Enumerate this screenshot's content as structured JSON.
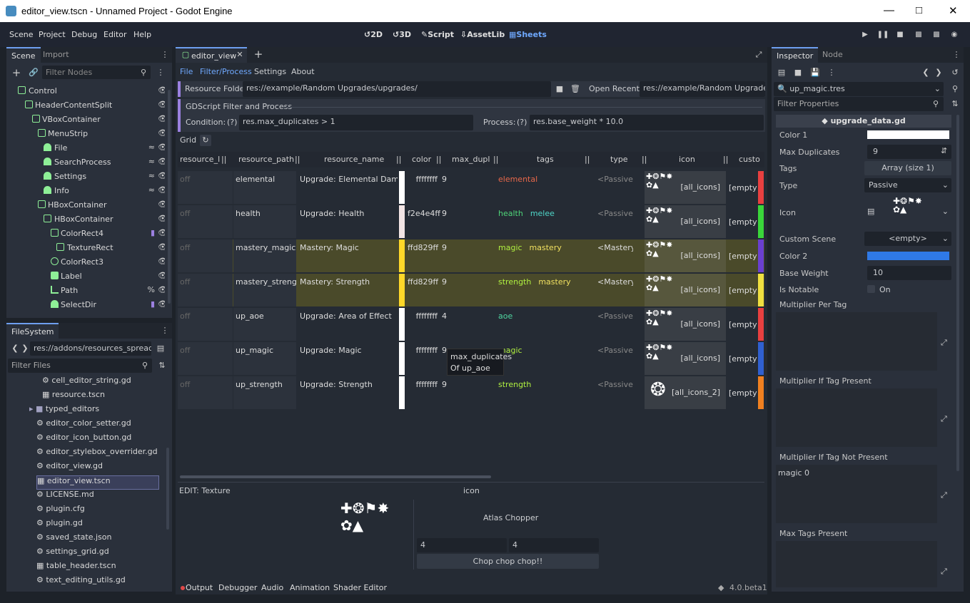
{
  "window": {
    "title": "editor_view.tscn - Unnamed Project - Godot Engine"
  },
  "menu": [
    "Scene",
    "Project",
    "Debug",
    "Editor",
    "Help"
  ],
  "workspaces": [
    "2D",
    "3D",
    "Script",
    "AssetLib",
    "Sheets"
  ],
  "scene_dock": {
    "tabs": [
      "Scene",
      "Import"
    ],
    "filter_placeholder": "Filter Nodes",
    "nodes": [
      "Control",
      "HeaderContentSplit",
      "VBoxContainer",
      "MenuStrip",
      "File",
      "SearchProcess",
      "Settings",
      "Info",
      "HBoxContainer",
      "HBoxContainer",
      "ColorRect4",
      "TextureRect",
      "ColorRect3",
      "Label",
      "Path",
      "SelectDir"
    ]
  },
  "filesystem": {
    "tab": "FileSystem",
    "path": "res://addons/resources_spreadshe",
    "filter_placeholder": "Filter Files",
    "files": [
      "cell_editor_string.gd",
      "resource.tscn",
      "typed_editors",
      "editor_color_setter.gd",
      "editor_icon_button.gd",
      "editor_stylebox_overrider.gd",
      "editor_view.gd",
      "editor_view.tscn",
      "LICENSE.md",
      "plugin.cfg",
      "plugin.gd",
      "saved_state.json",
      "settings_grid.gd",
      "table_header.tscn",
      "text_editing_utils.gd"
    ]
  },
  "center": {
    "tab": "editor_view",
    "submenu": [
      "File",
      "Filter/Process",
      "Settings",
      "About"
    ],
    "resource_folder_label": "Resource Folder:",
    "resource_folder": "res://example/Random Upgrades/upgrades/",
    "open_recent_label": "Open Recent:",
    "open_recent": "res://example/Random Upgrades/u",
    "gdscript_title": "GDScript Filter and Process",
    "condition_label": "Condition:",
    "condition_help": "(?)",
    "condition": "res.max_duplicates > 1",
    "process_label": "Process:",
    "process_help": "(?)",
    "process": "res.base_weight * 10.0",
    "grid_label": "Grid",
    "columns": [
      "resource_l",
      "resource_path",
      "resource_name",
      "color",
      "max_dupl",
      "tags",
      "type",
      "icon",
      "custo"
    ],
    "rows": [
      {
        "lock": "off",
        "path": "elemental",
        "name": "Upgrade: Elemental Damage",
        "color": "ffffffff",
        "swatch": "#ffffff",
        "dup": "9",
        "tags": [
          {
            "t": "elemental",
            "c": "#e8684a"
          }
        ],
        "type": "<Passive>",
        "icon": "[all_icons]",
        "custom": "[empty]",
        "bar": "#e84040",
        "hl": ""
      },
      {
        "lock": "off",
        "path": "health",
        "name": "Upgrade: Health",
        "color": "f2e4e4ff",
        "swatch": "#f2e4e4",
        "dup": "9",
        "tags": [
          {
            "t": "health",
            "c": "#4fd67a"
          },
          {
            "t": "melee",
            "c": "#4fd6c8"
          }
        ],
        "type": "<Passive>",
        "icon": "[all_icons]",
        "custom": "[empty]",
        "bar": "#3ad63a",
        "hl": ""
      },
      {
        "lock": "off",
        "path": "mastery_magic",
        "name": "Mastery: Magic",
        "color": "ffd829ff",
        "swatch": "#ffd829",
        "dup": "9",
        "tags": [
          {
            "t": "magic",
            "c": "#b0f040"
          },
          {
            "t": "mastery",
            "c": "#f0e060"
          }
        ],
        "type": "<Mastery>",
        "icon": "[all_icons]",
        "custom": "[empty]",
        "bar": "#6a3fd0",
        "hl": "#4a4a2a"
      },
      {
        "lock": "off",
        "path": "mastery_strength",
        "name": "Mastery: Strength",
        "color": "ffd829ff",
        "swatch": "#ffd829",
        "dup": "9",
        "tags": [
          {
            "t": "strength",
            "c": "#b0f040"
          },
          {
            "t": "mastery",
            "c": "#f0e060"
          }
        ],
        "type": "<Mastery>",
        "icon": "[all_icons]",
        "custom": "[empty]",
        "bar": "#f0e040",
        "hl": "#4a4a2a"
      },
      {
        "lock": "off",
        "path": "up_aoe",
        "name": "Upgrade: Area of Effect",
        "color": "ffffffff",
        "swatch": "#ffffff",
        "dup": "4",
        "tags": [
          {
            "t": "aoe",
            "c": "#4fd6a0"
          }
        ],
        "type": "<Passive>",
        "icon": "[all_icons]",
        "custom": "[empty]",
        "bar": "#e84040",
        "hl": ""
      },
      {
        "lock": "off",
        "path": "up_magic",
        "name": "Upgrade: Magic",
        "color": "ffffffff",
        "swatch": "#ffffff",
        "dup": "9",
        "tags": [
          {
            "t": "magic",
            "c": "#b0f040"
          }
        ],
        "type": "<Passive>",
        "icon": "[all_icons]",
        "custom": "[empty]",
        "bar": "#3060d0",
        "hl": ""
      },
      {
        "lock": "off",
        "path": "up_strength",
        "name": "Upgrade: Strength",
        "color": "ffffffff",
        "swatch": "#ffffff",
        "dup": "9",
        "tags": [
          {
            "t": "strength",
            "c": "#b0f040"
          }
        ],
        "type": "<Passive>",
        "icon": "[all_icons_2]",
        "custom": "[empty]",
        "bar": "#f08020",
        "hl": ""
      }
    ],
    "tooltip": [
      "max_duplicates",
      "Of up_aoe"
    ],
    "edit_label": "EDIT: Texture",
    "edit_column": "icon",
    "atlas_title": "Atlas Chopper",
    "atlas_w": "4",
    "atlas_h": "4",
    "chop_button": "Chop chop chop!!"
  },
  "bottom": {
    "tabs": [
      "Output",
      "Debugger",
      "Audio",
      "Animation",
      "Shader Editor"
    ],
    "version": "4.0.beta1"
  },
  "inspector": {
    "tabs": [
      "Inspector",
      "Node"
    ],
    "resource": "up_magic.tres",
    "filter_placeholder": "Filter Properties",
    "script": "upgrade_data.gd",
    "props": {
      "color1": "Color 1",
      "max_dup_label": "Max Duplicates",
      "max_dup": "9",
      "tags_label": "Tags",
      "tags": "Array (size 1)",
      "type_label": "Type",
      "type": "Passive",
      "icon_label": "Icon",
      "custom_scene_label": "Custom Scene",
      "custom_scene": "<empty>",
      "color2": "Color 2",
      "base_weight_label": "Base Weight",
      "base_weight": "10",
      "notable_label": "Is Notable",
      "notable": "On",
      "mult_per_tag": "Multiplier Per Tag",
      "mult_if_present": "Multiplier If Tag Present",
      "mult_if_not": "Multiplier If Tag Not Present",
      "mult_if_not_value": "magic 0",
      "max_tags": "Max Tags Present"
    },
    "color1_hex": "#ffffff",
    "color2_hex": "#2f79e6"
  }
}
